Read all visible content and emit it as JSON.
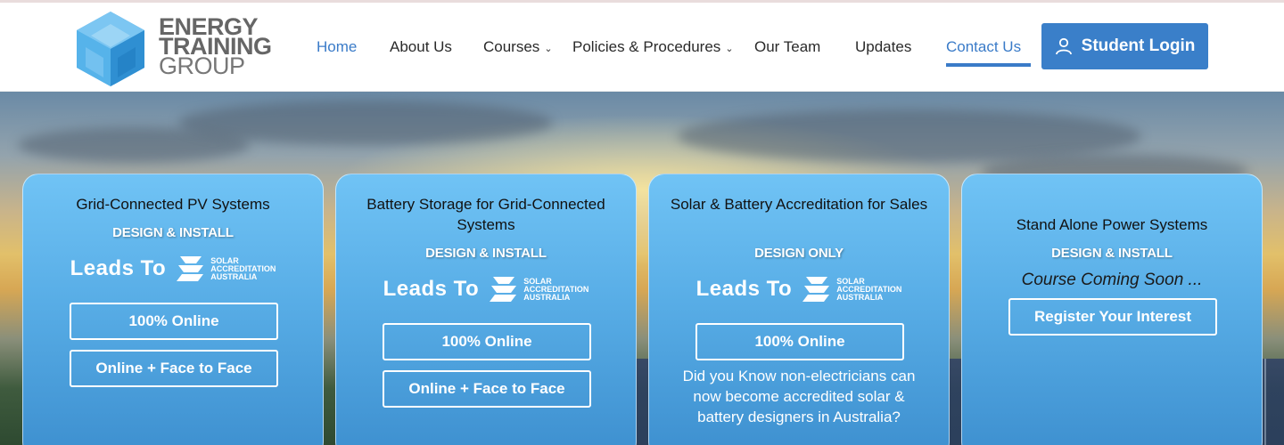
{
  "logo": {
    "line1": "ENERGY",
    "line2": "TRAINING",
    "line3": "GROUP"
  },
  "nav": {
    "items": [
      {
        "label": "Home"
      },
      {
        "label": "About Us"
      },
      {
        "label": "Courses"
      },
      {
        "label": "Policies & Procedures"
      },
      {
        "label": "Our Team"
      },
      {
        "label": "Updates"
      },
      {
        "label": "Contact Us"
      }
    ],
    "login_label": "Student Login"
  },
  "colors": {
    "accent": "#3a7bc8",
    "card_top": "#70c3f5",
    "card_bottom": "#3d8fcf"
  },
  "leads_to_text": "Leads To",
  "saa_logo": {
    "line1": "SOLAR",
    "line2": "ACCREDITATION",
    "line3": "AUSTRALIA"
  },
  "cards": [
    {
      "title": "Grid-Connected PV Systems",
      "subtitle": "DESIGN & INSTALL",
      "buttons": [
        "100% Online",
        "Online + Face to Face"
      ]
    },
    {
      "title": "Battery Storage for Grid-Connected Systems",
      "subtitle": "DESIGN & INSTALL",
      "buttons": [
        "100% Online",
        "Online + Face to Face"
      ]
    },
    {
      "title": "Solar & Battery Accreditation for Sales",
      "subtitle": "DESIGN ONLY",
      "buttons": [
        "100% Online"
      ],
      "note": "Did you Know non-electricians can now become accredited solar & battery designers in Australia?"
    },
    {
      "title": "Stand Alone Power Systems",
      "subtitle": "DESIGN & INSTALL",
      "coming_soon": "Course Coming Soon ...",
      "buttons": [
        "Register Your Interest"
      ]
    }
  ]
}
